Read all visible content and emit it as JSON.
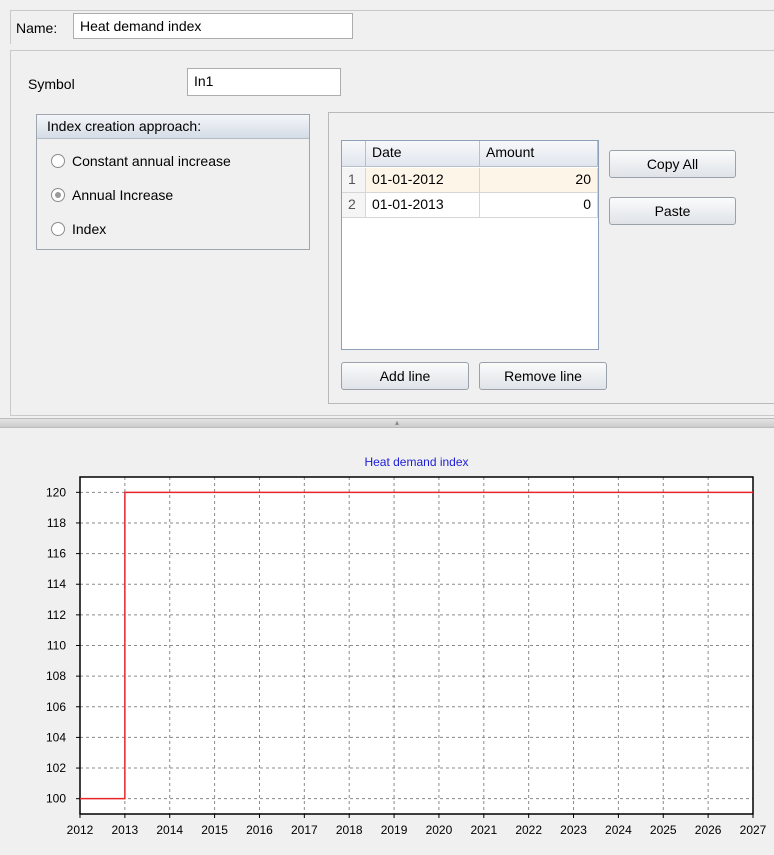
{
  "name_row": {
    "label": "Name:",
    "value": "Heat demand index"
  },
  "symbol": {
    "label": "Symbol",
    "value": "In1"
  },
  "approach": {
    "title": "Index creation approach:",
    "options": [
      "Constant annual increase",
      "Annual Increase",
      "Index"
    ],
    "selected": "Annual Increase"
  },
  "table": {
    "columns": [
      "Date",
      "Amount"
    ],
    "rows": [
      {
        "num": "1",
        "date": "01-01-2012",
        "amount": "20"
      },
      {
        "num": "2",
        "date": "01-01-2013",
        "amount": "0"
      }
    ]
  },
  "buttons": {
    "copy_all": "Copy All",
    "paste": "Paste",
    "add_line": "Add line",
    "remove_line": "Remove line"
  },
  "chart_data": {
    "type": "line",
    "title": "Heat demand index",
    "xlabel": "",
    "ylabel": "",
    "x_ticks": [
      "2012",
      "2013",
      "2014",
      "2015",
      "2016",
      "2017",
      "2018",
      "2019",
      "2020",
      "2021",
      "2022",
      "2023",
      "2024",
      "2025",
      "2026",
      "2027"
    ],
    "y_ticks": [
      "100",
      "102",
      "104",
      "106",
      "108",
      "110",
      "112",
      "114",
      "116",
      "118",
      "120"
    ],
    "xlim": [
      2012,
      2027
    ],
    "ylim": [
      99,
      121
    ],
    "grid": true,
    "series": [
      {
        "step": true,
        "x": [
          2012,
          2013,
          2027
        ],
        "y": [
          100,
          120,
          120
        ],
        "color": "#e8262a"
      }
    ]
  }
}
